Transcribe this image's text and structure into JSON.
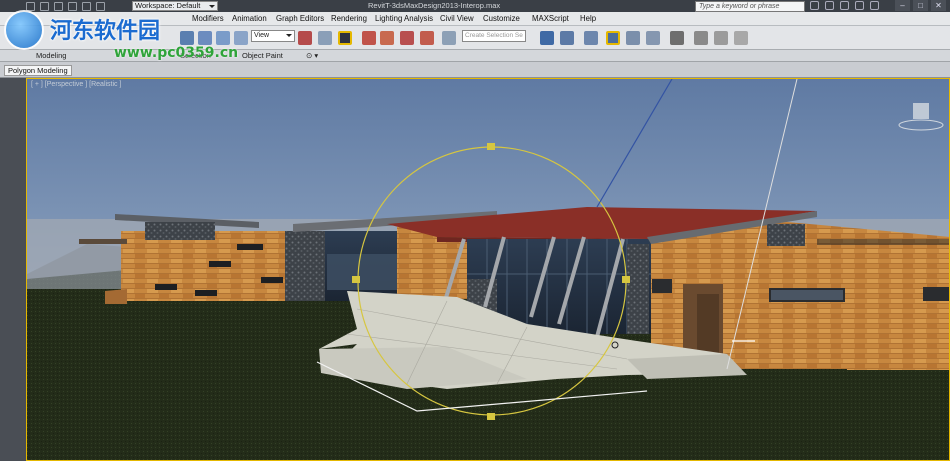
{
  "titlebar": {
    "workspace": "Workspace: Default",
    "document_title": "RevitT-3dsMaxDesign2013-Interop.max",
    "search_placeholder": "Type a keyword or phrase",
    "win_min": "–",
    "win_max": "□",
    "win_close": "✕"
  },
  "menus": [
    "Modifiers",
    "Animation",
    "Graph Editors",
    "Rendering",
    "Lighting Analysis",
    "Civil View",
    "Customize",
    "MAXScript",
    "Help"
  ],
  "toolbar": {
    "view_select": "View",
    "selection_set_placeholder": "Create Selection Se"
  },
  "ribbon": {
    "tabs": [
      "Modeling",
      "Selection",
      "Object Paint"
    ],
    "panel": "Polygon Modeling"
  },
  "viewport": {
    "label": "[ + ] [Perspective ] [Realistic ]"
  },
  "watermark": {
    "text": "河东软件园",
    "url": "www.pc0359.cn"
  },
  "colors": {
    "accent": "#e5b800",
    "gizmo": "#d6c640",
    "sky_top": "#5f7aa3",
    "grass": "#26301b",
    "wood": "#c7873f",
    "roof": "#8a2f27"
  }
}
